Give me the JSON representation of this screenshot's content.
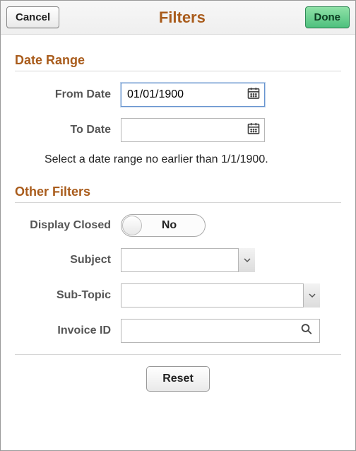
{
  "header": {
    "cancel_label": "Cancel",
    "title": "Filters",
    "done_label": "Done"
  },
  "date_range": {
    "section_title": "Date Range",
    "from_label": "From Date",
    "from_value": "01/01/1900",
    "to_label": "To Date",
    "to_value": "",
    "helper": "Select a date range no earlier than 1/1/1900."
  },
  "other_filters": {
    "section_title": "Other Filters",
    "display_closed_label": "Display Closed",
    "display_closed_value": "No",
    "subject_label": "Subject",
    "subject_value": "",
    "subtopic_label": "Sub-Topic",
    "subtopic_value": "",
    "invoice_label": "Invoice ID",
    "invoice_value": ""
  },
  "footer": {
    "reset_label": "Reset"
  }
}
